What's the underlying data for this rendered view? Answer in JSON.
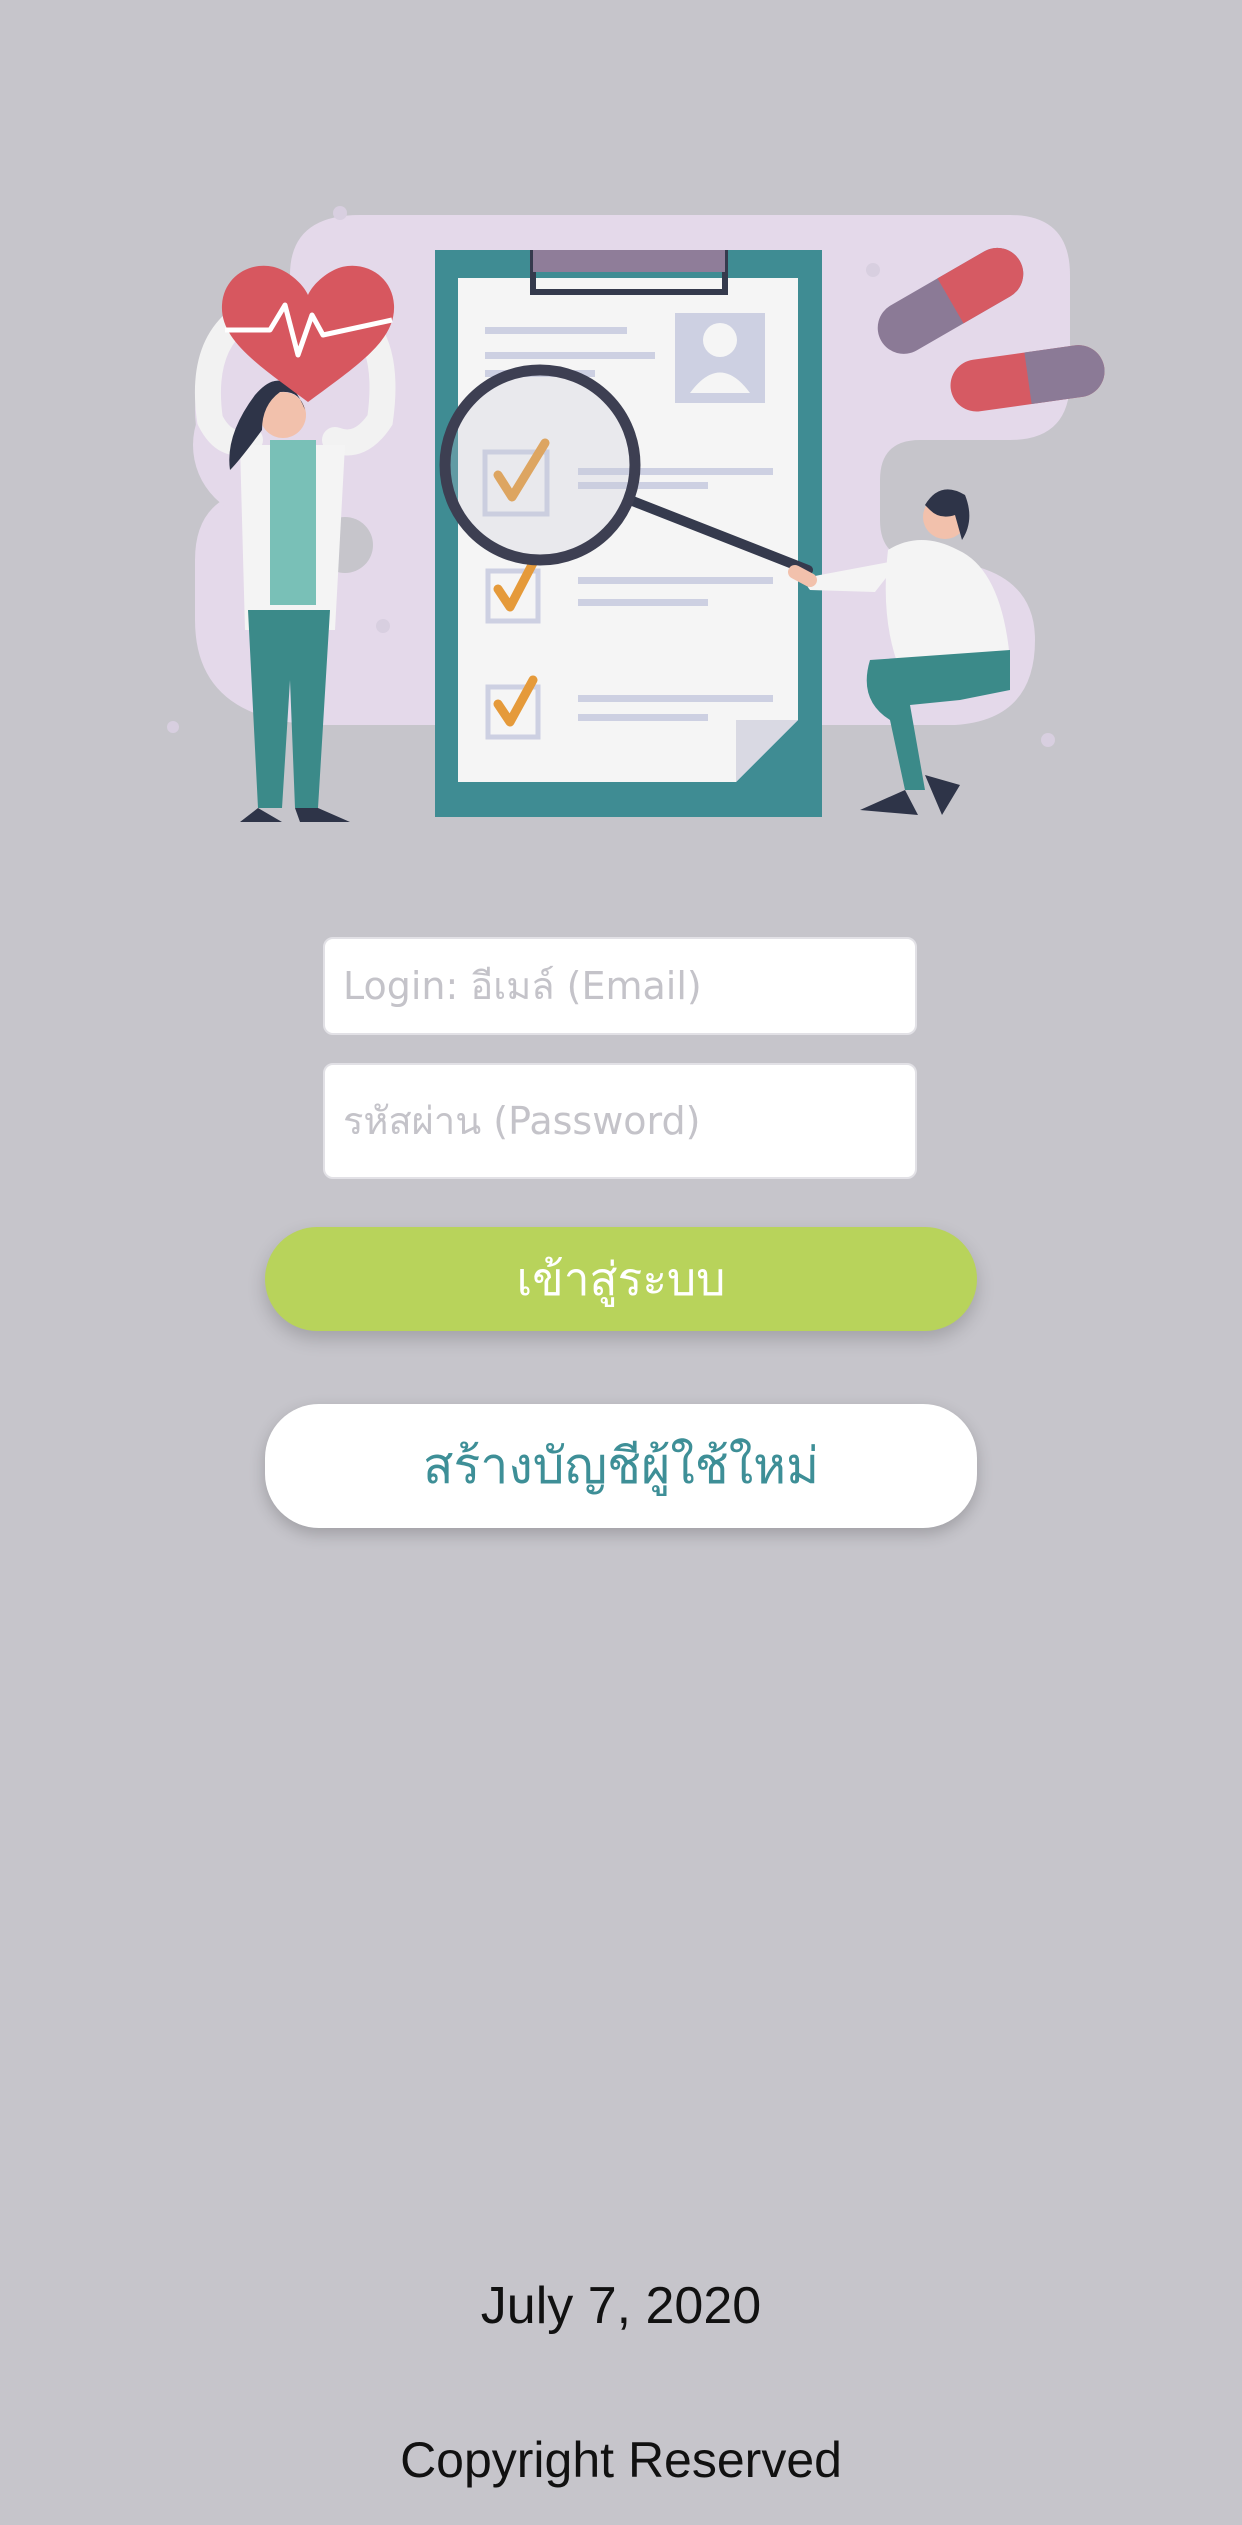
{
  "login_form": {
    "email_placeholder": "Login: อีเมล์ (Email)",
    "password_placeholder": "รหัสผ่าน (Password)",
    "login_button_label": "เข้าสู่ระบบ",
    "register_button_label": "สร้างบัญชีผู้ใช้ใหม่"
  },
  "footer": {
    "date": "July 7, 2020",
    "copyright": "Copyright Reserved"
  },
  "colors": {
    "background": "#c6c5cb",
    "login_button": "#b8d35b",
    "register_text": "#3e8f97"
  },
  "illustration": {
    "icons": [
      "heart-pulse-icon",
      "clipboard-checklist-icon",
      "magnifier-icon",
      "pill-icon",
      "doctor-figure",
      "patient-figure"
    ]
  }
}
